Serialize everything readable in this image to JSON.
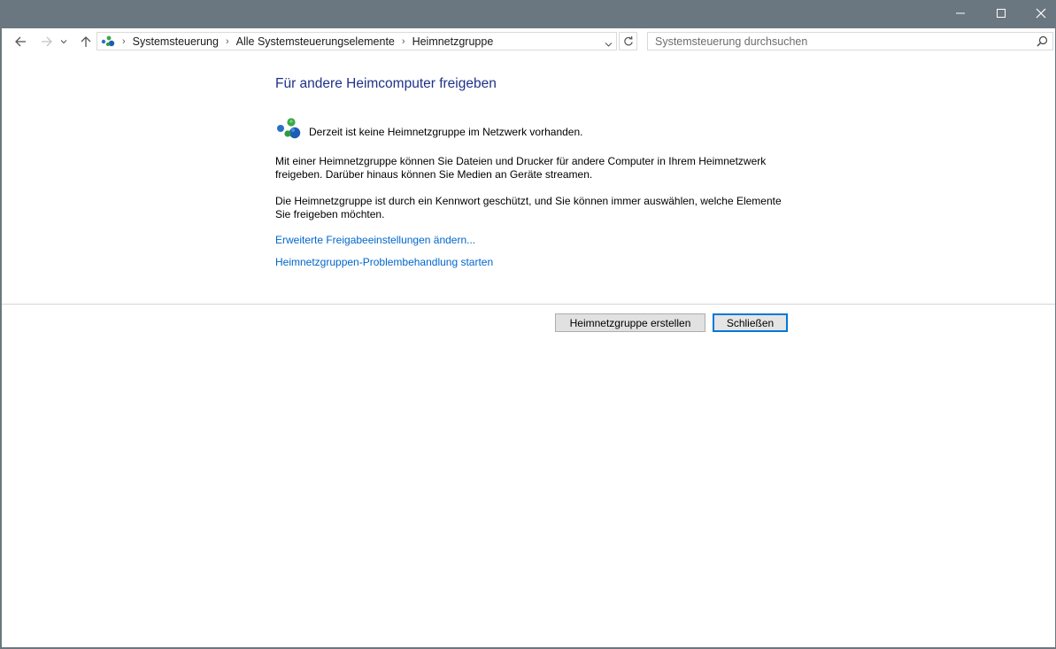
{
  "window": {
    "title": "",
    "minimize_glyph": "—",
    "maximize_glyph": "☐",
    "close_glyph": "✕"
  },
  "nav": {
    "breadcrumb": [
      "Systemsteuerung",
      "Alle Systemsteuerungselemente",
      "Heimnetzgruppe"
    ],
    "search_placeholder": "Systemsteuerung durchsuchen"
  },
  "main": {
    "heading": "Für andere Heimcomputer freigeben",
    "status": "Derzeit ist keine Heimnetzgruppe im Netzwerk vorhanden.",
    "paragraph1": "Mit einer Heimnetzgruppe können Sie Dateien und Drucker für andere Computer in Ihrem Heimnetzwerk freigeben. Darüber hinaus können Sie Medien an Geräte streamen.",
    "paragraph2": "Die Heimnetzgruppe ist durch ein Kennwort geschützt, und Sie können immer auswählen, welche Elemente Sie freigeben möchten.",
    "link_advanced": "Erweiterte Freigabeeinstellungen ändern...",
    "link_troubleshoot": "Heimnetzgruppen-Problembehandlung starten"
  },
  "buttons": {
    "create": "Heimnetzgruppe erstellen",
    "close": "Schließen"
  },
  "colors": {
    "titlebar": "#6b7780",
    "heading": "#1e3287",
    "link": "#0066cc",
    "focus_border": "#0078d7"
  },
  "icons": {
    "homegroup": "homegroup-icon",
    "back": "back-arrow-icon",
    "forward": "forward-arrow-icon",
    "up": "up-arrow-icon",
    "refresh": "refresh-icon",
    "search": "search-icon"
  }
}
